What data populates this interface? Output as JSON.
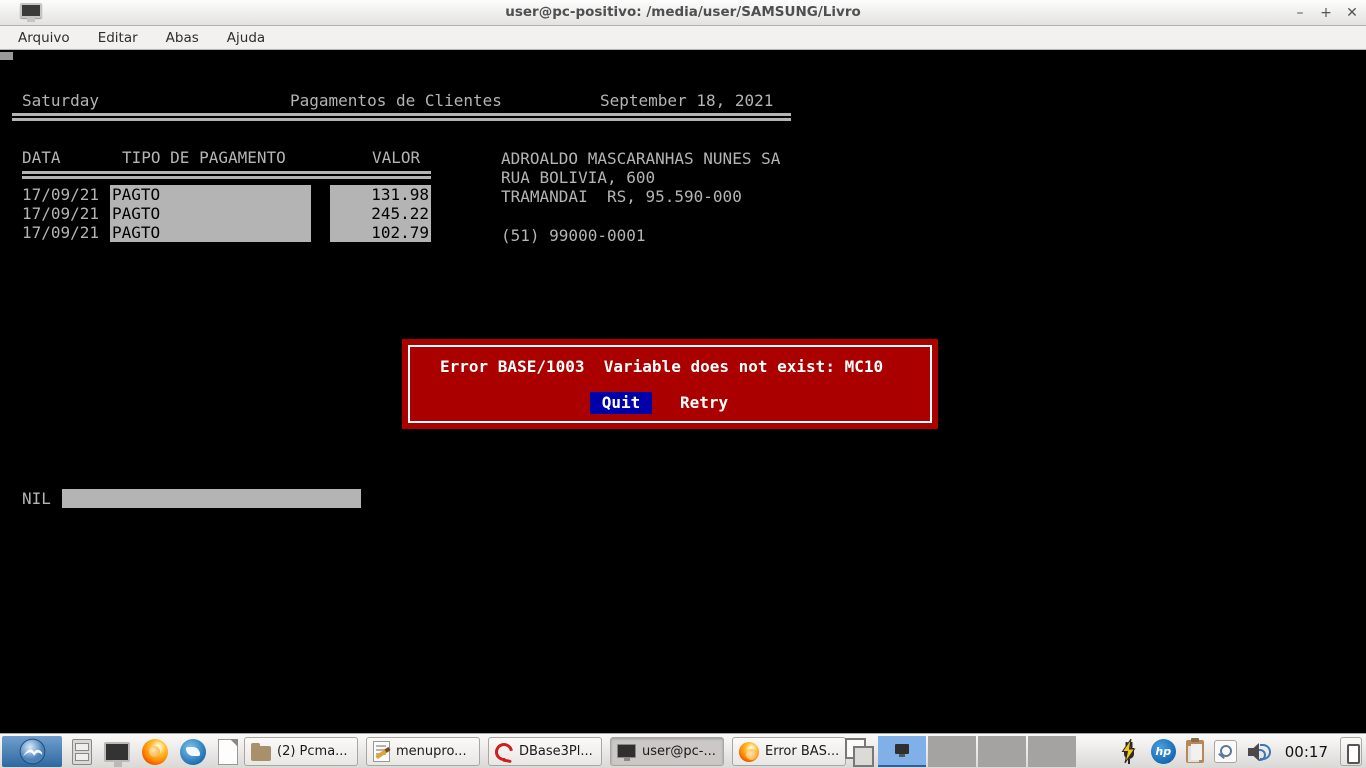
{
  "window": {
    "title": "user@pc-positivo: /media/user/SAMSUNG/Livro",
    "controls": {
      "minimize": "–",
      "maximize": "+",
      "close": "✕"
    }
  },
  "menubar": {
    "items": [
      {
        "label": "Arquivo"
      },
      {
        "label": "Editar"
      },
      {
        "label": "Abas"
      },
      {
        "label": "Ajuda"
      }
    ]
  },
  "terminal": {
    "header": {
      "day": "Saturday",
      "title": "Pagamentos de Clientes",
      "date": "September 18, 2021"
    },
    "table": {
      "columns": {
        "data": "DATA",
        "tipo": "TIPO DE PAGAMENTO",
        "valor": "VALOR"
      },
      "rows": [
        {
          "data": "17/09/21",
          "tipo": "PAGTO",
          "valor": "131.98"
        },
        {
          "data": "17/09/21",
          "tipo": "PAGTO",
          "valor": "245.22"
        },
        {
          "data": "17/09/21",
          "tipo": "PAGTO",
          "valor": "102.79"
        }
      ]
    },
    "customer": {
      "name": "ADROALDO MASCARANHAS NUNES SA",
      "address": "RUA BOLIVIA, 600",
      "city_line": "TRAMANDAI  RS, 95.590-000",
      "phone": "(51) 99000-0001"
    },
    "dialog": {
      "message": "Error BASE/1003  Variable does not exist: MC10",
      "quit_label": "Quit",
      "retry_label": "Retry"
    },
    "status_label": "NIL"
  },
  "taskbar": {
    "windows": [
      {
        "label": "(2) Pcma...",
        "icon": "folder-icon",
        "active": false
      },
      {
        "label": "menupro...",
        "icon": "text-editor-icon",
        "active": false
      },
      {
        "label": "DBase3Pl...",
        "icon": "dbase-icon",
        "active": false
      },
      {
        "label": "user@pc-...",
        "icon": "terminal-icon",
        "active": true
      },
      {
        "label": "Error BAS...",
        "icon": "firefox-icon",
        "active": false
      }
    ],
    "hp_text": "hp",
    "clock": "00:17"
  },
  "colors": {
    "terminal_bg": "#000000",
    "terminal_fg": "#b4b4b4",
    "dialog_red": "#aa0000",
    "selection_blue": "#0000aa",
    "dialog_text": "#ffffff",
    "workspace_active": "#7fb1e8",
    "panel_bg": "#e9e7e4",
    "menu_button_blue": "#2e68a0"
  }
}
